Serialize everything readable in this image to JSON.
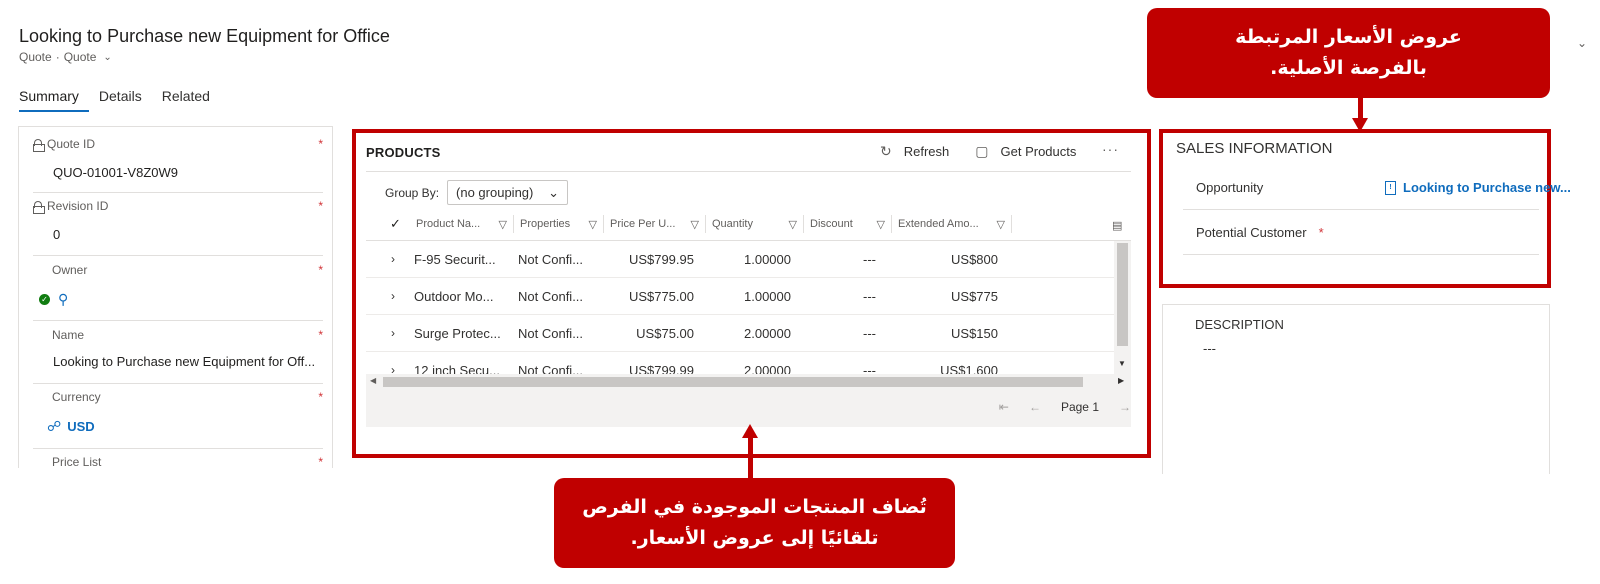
{
  "header": {
    "title": "Looking to Purchase new Equipment for Office",
    "breadcrumb": [
      "Quote",
      "·",
      "Quote"
    ],
    "breadcrumb_chevron_icon": "chevron-down-icon"
  },
  "tabs": [
    {
      "label": "Summary",
      "active": true
    },
    {
      "label": "Details",
      "active": false
    },
    {
      "label": "Related",
      "active": false
    }
  ],
  "form": {
    "quote_id": {
      "label": "Quote ID",
      "value": "QUO-01001-V8Z0W9",
      "required": "*"
    },
    "revision_id": {
      "label": "Revision ID",
      "value": "0",
      "required": "*"
    },
    "owner": {
      "label": "Owner",
      "required": "*"
    },
    "name": {
      "label": "Name",
      "value": "Looking to Purchase new Equipment for Off...",
      "required": "*"
    },
    "currency": {
      "label": "Currency",
      "value": "USD",
      "required": "*"
    },
    "price_list": {
      "label": "Price List",
      "required": "*"
    }
  },
  "products": {
    "title": "PRODUCTS",
    "refresh_label": "Refresh",
    "get_products_label": "Get Products",
    "more_label": "···",
    "group_by_label": "Group By:",
    "group_by_value": "(no grouping)",
    "columns": [
      "Product Na...",
      "Properties",
      "Price Per U...",
      "Quantity",
      "Discount",
      "Extended Amo..."
    ],
    "rows": [
      {
        "name": "F-95 Securit...",
        "properties": "Not Confi...",
        "price": "US$799.95",
        "quantity": "1.00000",
        "discount": "---",
        "extended": "US$800"
      },
      {
        "name": "Outdoor Mo...",
        "properties": "Not Confi...",
        "price": "US$775.00",
        "quantity": "1.00000",
        "discount": "---",
        "extended": "US$775"
      },
      {
        "name": "Surge Protec...",
        "properties": "Not Confi...",
        "price": "US$75.00",
        "quantity": "2.00000",
        "discount": "---",
        "extended": "US$150"
      },
      {
        "name": "12 inch Secu...",
        "properties": "Not Confi...",
        "price": "US$799.99",
        "quantity": "2.00000",
        "discount": "---",
        "extended": "US$1,600"
      }
    ],
    "page_label": "Page 1"
  },
  "sales": {
    "title": "SALES INFORMATION",
    "opportunity_label": "Opportunity",
    "opportunity_value": "Looking to Purchase new...",
    "potential_customer_label": "Potential Customer",
    "potential_customer_required": "*"
  },
  "description": {
    "title": "DESCRIPTION",
    "value": "---"
  },
  "callouts": {
    "top": [
      "عروض الأسعار المرتبطة",
      "بالفرصة الأصلية."
    ],
    "bottom": [
      "تُضاف المنتجات الموجودة في الفرص",
      "تلقائيًا إلى عروض الأسعار."
    ]
  },
  "colors": {
    "accent": "#0f6cbd",
    "callout": "#c00000",
    "required": "#d13438"
  }
}
